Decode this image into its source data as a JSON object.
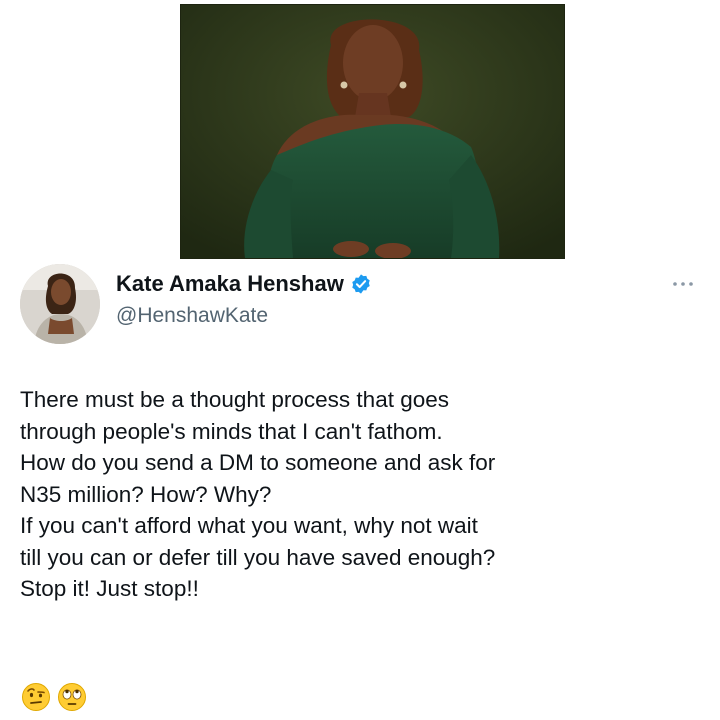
{
  "tweet": {
    "author": {
      "display_name": "Kate Amaka Henshaw",
      "handle": "@HenshawKate",
      "verified": true
    },
    "body_lines": [
      "There must be a thought process that goes",
      "through people's minds that I can't fathom.",
      "How do you send a DM to someone and ask for",
      "N35 million? How? Why?",
      "If you can't afford what you want, why not wait",
      "till you can or defer till you have saved enough?",
      "Stop it! Just stop!!"
    ],
    "emojis": [
      "face-with-raised-eyebrow-icon",
      "face-with-rolling-eyes-icon"
    ]
  },
  "colors": {
    "text_primary": "#0f1419",
    "text_secondary": "#536471",
    "verified_blue": "#1d9bf0",
    "photo_background": "#2b3419",
    "dress_green": "#1f4a33"
  }
}
